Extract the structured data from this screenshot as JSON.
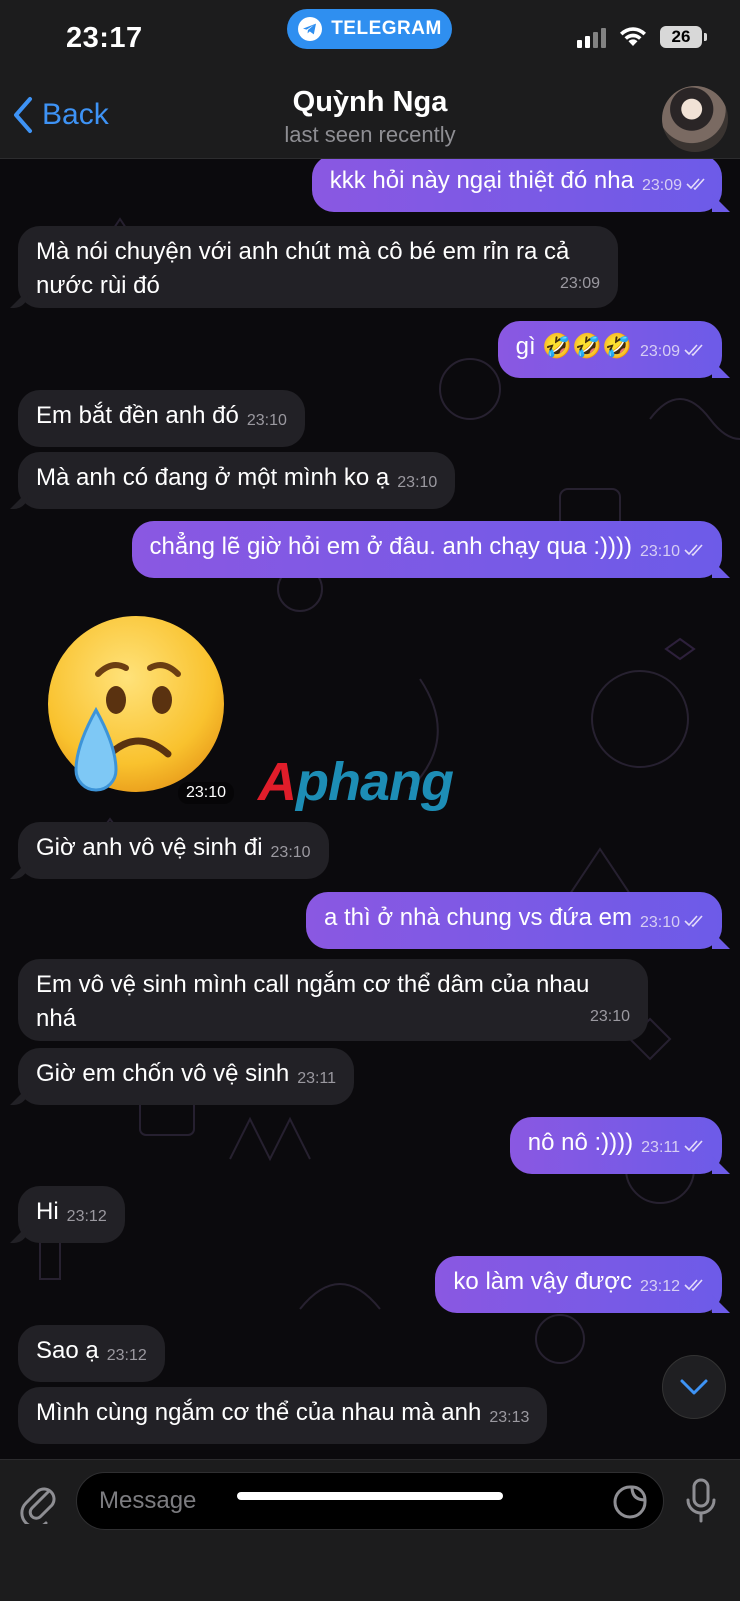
{
  "status_bar": {
    "time": "23:17",
    "app_label": "TELEGRAM",
    "battery": "26"
  },
  "header": {
    "back_label": "Back",
    "contact_name": "Quỳnh Nga",
    "last_seen": "last seen recently"
  },
  "watermark": {
    "brand_a": "A",
    "brand_rest": "phang"
  },
  "messages": [
    {
      "text": "kkk hỏi này ngại thiệt đó nha",
      "time": "23:09",
      "direction": "outgoing",
      "read": true
    },
    {
      "text_line1": "Mà nói chuyện với anh chút mà cô bé em rỉn ra cả",
      "text_line2": "nước rùi đó",
      "time": "23:09",
      "direction": "incoming"
    },
    {
      "text": "gì 🤣🤣🤣",
      "time": "23:09",
      "direction": "outgoing",
      "read": true
    },
    {
      "text": "Em bắt đền anh đó",
      "time": "23:10",
      "direction": "incoming"
    },
    {
      "text": "Mà anh có đang ở một mình ko ạ",
      "time": "23:10",
      "direction": "incoming"
    },
    {
      "text": "chẳng lẽ giờ hỏi em ở đâu. anh chạy qua :))))",
      "time": "23:10",
      "direction": "outgoing",
      "read": true
    },
    {
      "type": "sticker",
      "emoji": "crying-face",
      "time": "23:10",
      "direction": "incoming"
    },
    {
      "text": "Giờ anh vô vệ sinh đi",
      "time": "23:10",
      "direction": "incoming"
    },
    {
      "text": "a thì ở nhà chung vs đứa em",
      "time": "23:10",
      "direction": "outgoing",
      "read": true
    },
    {
      "text_line1": "Em vô vệ sinh mình call ngắm cơ thể dâm của nhau",
      "text_line2": "nhá",
      "time": "23:10",
      "direction": "incoming"
    },
    {
      "text": "Giờ em chốn vô vệ sinh",
      "time": "23:11",
      "direction": "incoming"
    },
    {
      "text": "nô nô :))))",
      "time": "23:11",
      "direction": "outgoing",
      "read": true
    },
    {
      "text": "Hi",
      "time": "23:12",
      "direction": "incoming"
    },
    {
      "text": "ko làm vậy được",
      "time": "23:12",
      "direction": "outgoing",
      "read": true
    },
    {
      "text": "Sao ạ",
      "time": "23:12",
      "direction": "incoming"
    },
    {
      "text": "Mình cùng ngắm cơ thể của nhau mà anh",
      "time": "23:13",
      "direction": "incoming"
    }
  ],
  "composer": {
    "placeholder": "Message"
  },
  "colors": {
    "outgoing_bubble": "#7b55e4",
    "incoming_bubble": "#222126",
    "accent": "#3e93f5",
    "app_pill": "#2f8ff0"
  }
}
